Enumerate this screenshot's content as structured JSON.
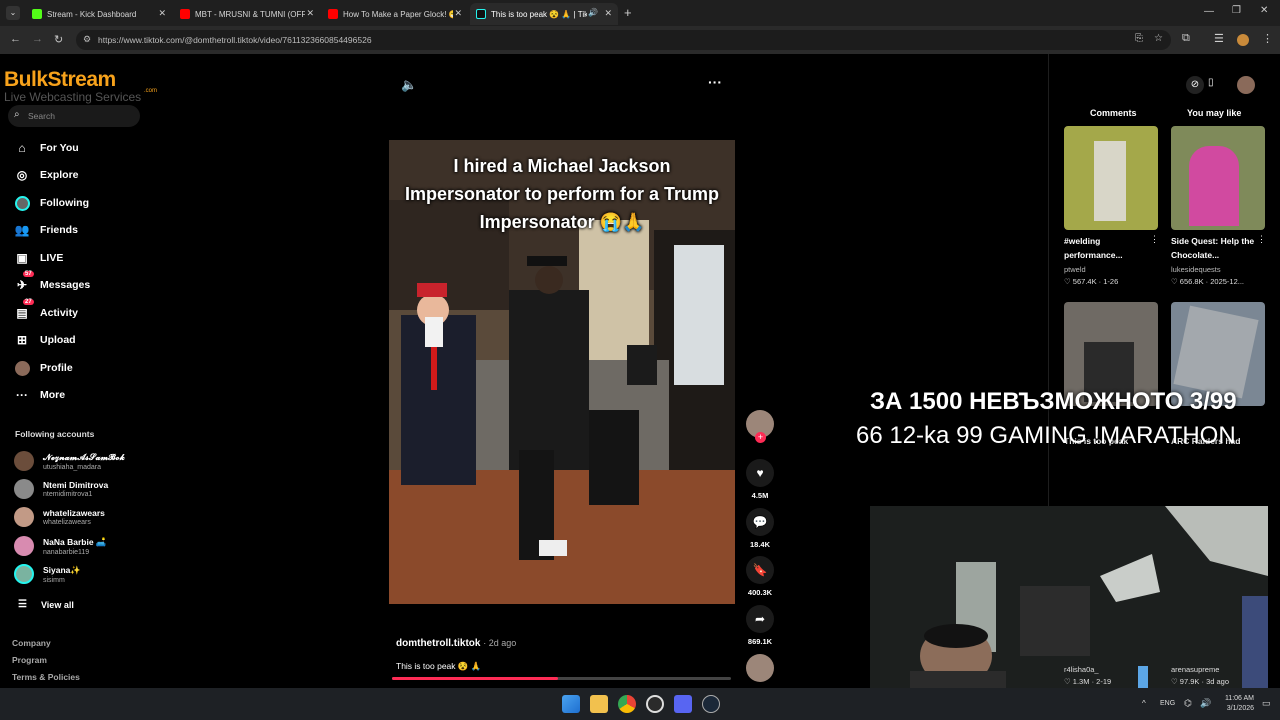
{
  "browser": {
    "tabs": [
      {
        "title": "Stream - Kick Dashboard",
        "favicon": "kick-icon"
      },
      {
        "title": "MBT - MRUSNI & TUMNI (OFFI",
        "favicon": "youtube-icon"
      },
      {
        "title": "How To Make a Paper Glock! 😁",
        "favicon": "youtube-icon"
      },
      {
        "title": "This is too peak 😵 🙏 | Tik",
        "favicon": "tiktok-icon"
      }
    ],
    "url": "https://www.tiktok.com/@domthetroll.tiktok/video/7611323660854496526"
  },
  "logo": {
    "brand": "BulkStream",
    "sub": "Live Webcasting Services",
    "tld": ".com"
  },
  "sidebar": {
    "search_placeholder": "Search",
    "nav": [
      {
        "label": "For You",
        "icon": "home-icon"
      },
      {
        "label": "Explore",
        "icon": "compass-icon"
      },
      {
        "label": "Following",
        "icon": "following-icon"
      },
      {
        "label": "Friends",
        "icon": "friends-icon"
      },
      {
        "label": "LIVE",
        "icon": "live-icon"
      },
      {
        "label": "Messages",
        "icon": "messages-icon",
        "badge": "57"
      },
      {
        "label": "Activity",
        "icon": "activity-icon",
        "badge": "27"
      },
      {
        "label": "Upload",
        "icon": "upload-icon"
      },
      {
        "label": "Profile",
        "icon": "profile-icon"
      },
      {
        "label": "More",
        "icon": "more-icon"
      }
    ],
    "following_title": "Following accounts",
    "accounts": [
      {
        "name": "𝓝𝓮𝔃𝓷𝓪𝓶𝓐𝓼𝓢𝓪𝓶𝓑𝓸𝓴",
        "handle": "utushiaha_madara"
      },
      {
        "name": "Ntemi Dimitrova",
        "handle": "ntemidimitrova1"
      },
      {
        "name": "whatelizawears",
        "handle": "whatelizawears"
      },
      {
        "name": "NaNa Barbie 🛋️",
        "handle": "nanabarbie119"
      },
      {
        "name": "Siyana✨",
        "handle": "sisimm"
      }
    ],
    "view_all": "View all",
    "footer": [
      "Company",
      "Program",
      "Terms & Policies"
    ]
  },
  "video": {
    "caption_overlay": "I hired a Michael Jackson Impersonator to perform for a Trump Impersonator 😭🙏",
    "author": "domthetroll.tiktok",
    "age": "· 2d ago",
    "description": "This is too peak 😵 🙏",
    "progress": 0.49
  },
  "actions": {
    "likes": "4.5M",
    "comments": "18.4K",
    "saves": "400.3K",
    "shares": "869.1K"
  },
  "right_panel": {
    "tabs": [
      "Comments",
      "You may like"
    ],
    "items": [
      {
        "title": "#welding performance...",
        "user": "ptweld",
        "stats": "♡ 567.4K · 1-26"
      },
      {
        "title": "Side Quest: Help the Chocolate...",
        "user": "lukesidequests",
        "stats": "♡ 656.8K · 2025-12..."
      },
      {
        "title": "This is too peak",
        "user": "",
        "stats": ""
      },
      {
        "title": "ARC Raiders had",
        "user": "",
        "stats": ""
      },
      {
        "title": "",
        "user": "r4lisha0a_",
        "stats": "♡ 1.3M · 2-19"
      },
      {
        "title": "",
        "user": "arenasupreme",
        "stats": "♡ 97.9K · 3d ago"
      }
    ]
  },
  "overlay": {
    "line1": "ЗА 1500 НЕВЪЗМОЖНОТО 3/99",
    "line2": "66 12-ka 99 GAMING !MARATHON"
  },
  "taskbar": {
    "lang": "ENG",
    "time": "11:06 AM",
    "date": "3/1/2026"
  },
  "colors": {
    "accent": "#fe2c55",
    "background": "#000000"
  }
}
